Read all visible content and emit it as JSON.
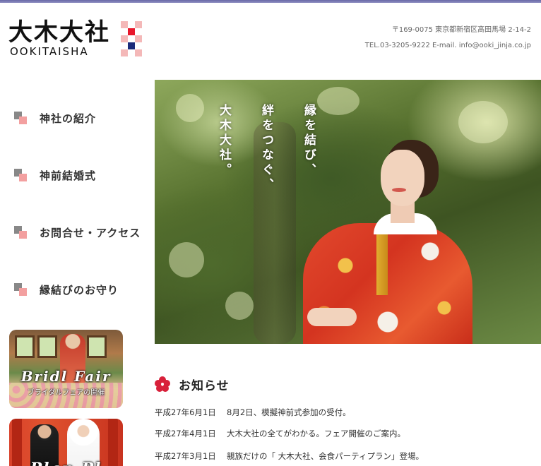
{
  "logo": {
    "kanji": "大木大社",
    "roman": "OOKITAISHA",
    "mark_colors": [
      "#e8172b",
      "#f4b8b8",
      "#1b2a7a"
    ]
  },
  "header": {
    "address": "〒169-0075 東京都新宿区高田馬場 2-14-2",
    "contact": "TEL.03-3205-9222 E-mail. info@ooki_jinja.co.jp"
  },
  "nav": {
    "items": [
      {
        "label": "神社の紹介",
        "icon": "square-bullet-icon"
      },
      {
        "label": "神前結婚式",
        "icon": "square-bullet-icon"
      },
      {
        "label": "お問合せ・アクセス",
        "icon": "square-bullet-icon"
      },
      {
        "label": "縁結びのお守り",
        "icon": "square-bullet-icon"
      }
    ]
  },
  "banners": [
    {
      "title": "Bridl Fair",
      "subtitle": "ブライダルフェアの開催"
    },
    {
      "title": "Plan Pl"
    }
  ],
  "hero": {
    "lines": [
      "縁を結び、",
      "絆をつなぐ、",
      "大木大社。"
    ]
  },
  "news": {
    "title": "お知らせ",
    "icon": "plum-blossom-icon",
    "items": [
      {
        "date": "平成27年6月1日",
        "text": "8月2日、模擬神前式参加の受付。"
      },
      {
        "date": "平成27年4月1日",
        "text": "大木大社の全てがわかる。フェア開催のご案内。"
      },
      {
        "date": "平成27年3月1日",
        "text": "親族だけの「 大木大社、会食パーティプラン」登場。"
      }
    ]
  },
  "colors": {
    "accent_red": "#d8203a",
    "top_bar": "#7a7ab4",
    "nav_icon_gray": "#888888",
    "nav_icon_pink": "#f3a0a0"
  }
}
